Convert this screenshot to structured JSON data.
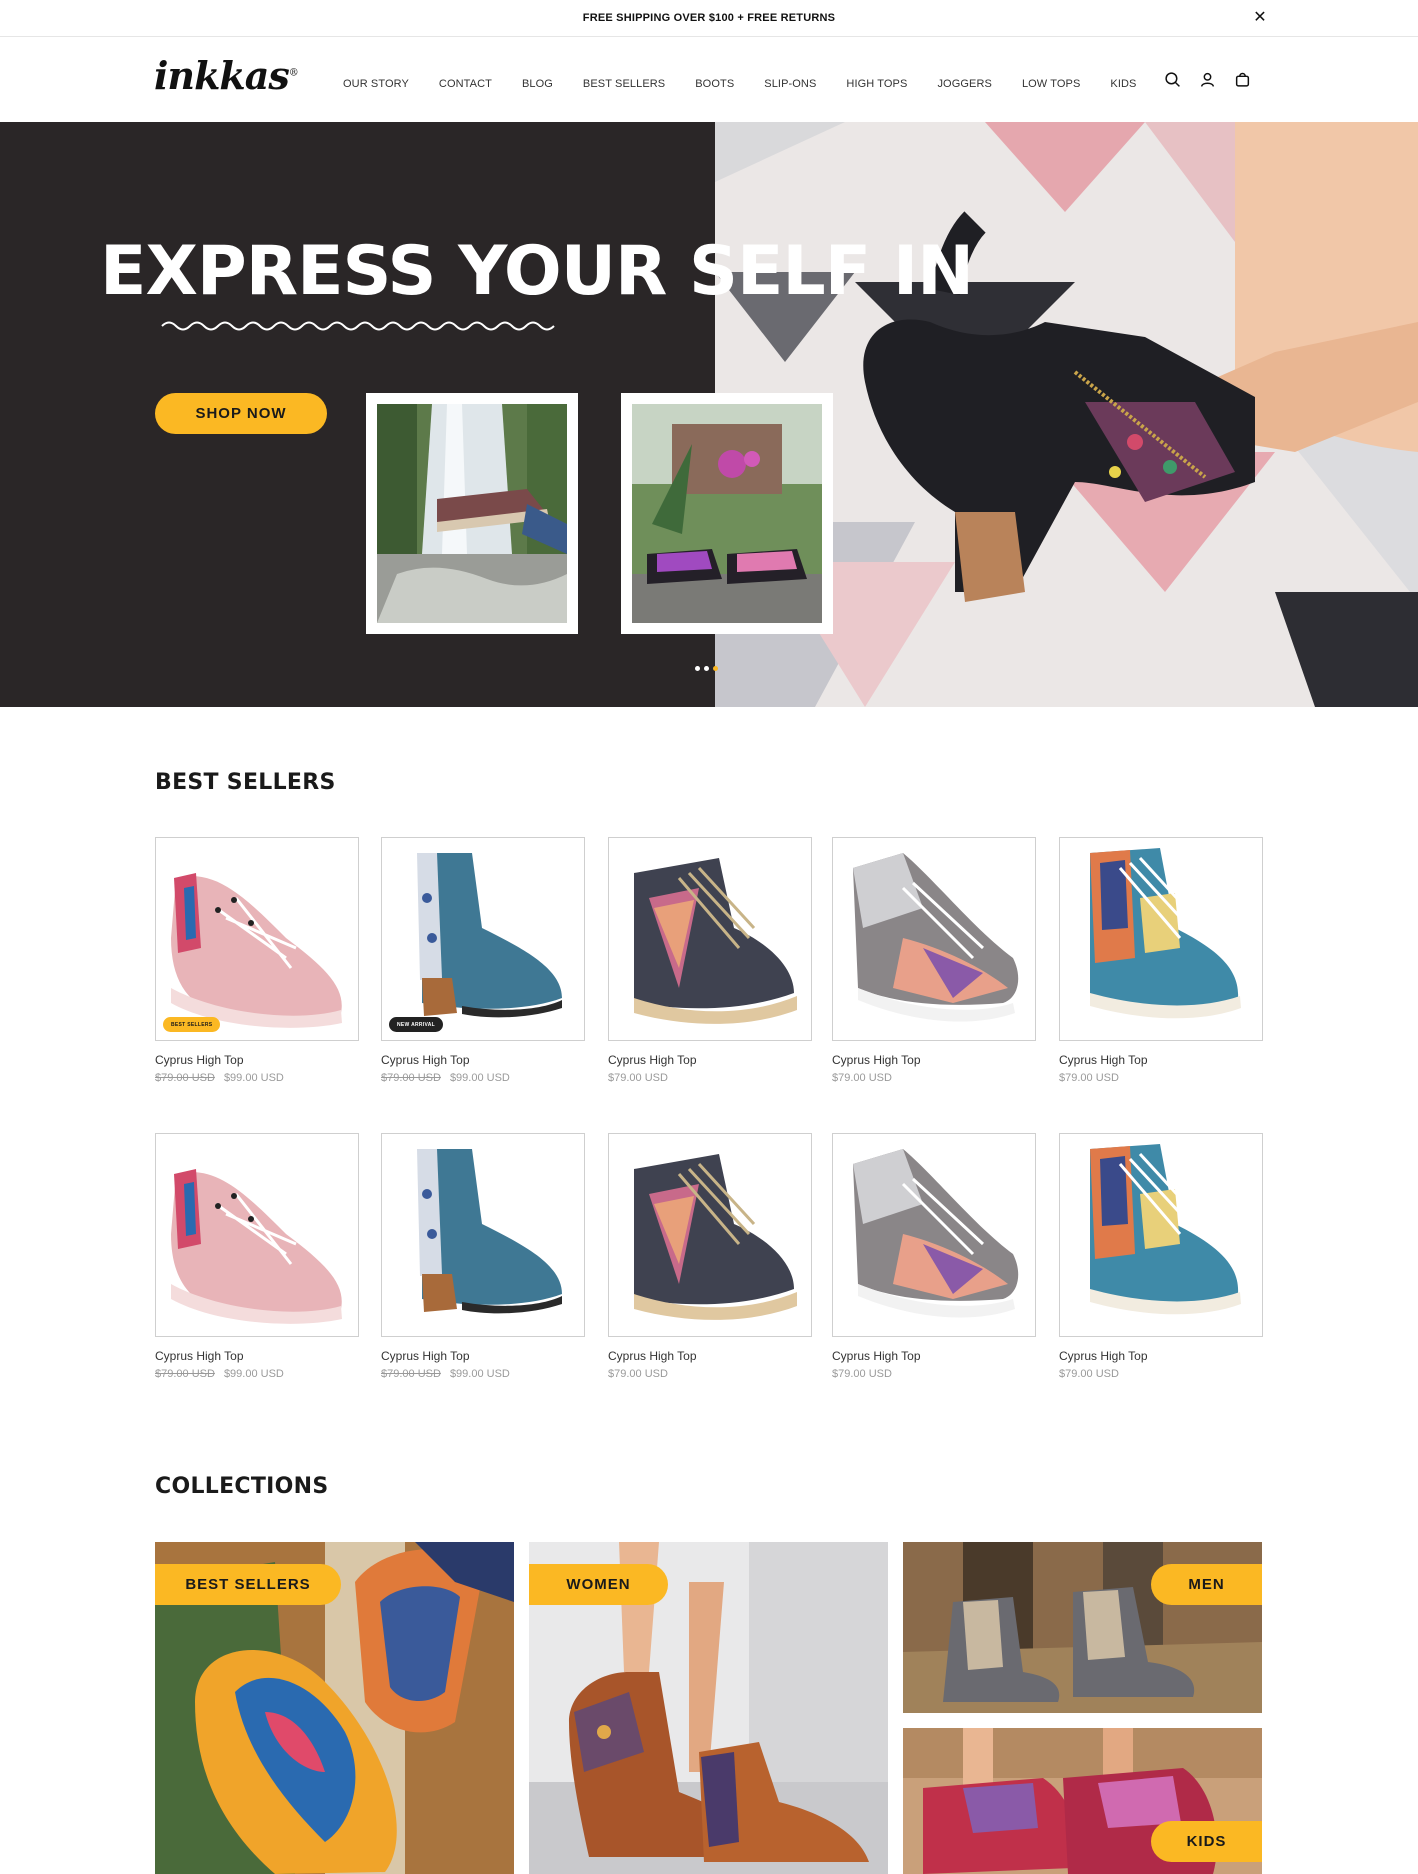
{
  "announcement": {
    "text": "FREE SHIPPING OVER $100 + FREE RETURNS",
    "close": "✕"
  },
  "header": {
    "logo": "inkkas",
    "logo_mark": "®",
    "nav": [
      "OUR STORY",
      "CONTACT",
      "BLOG",
      "BEST SELLERS",
      "BOOTS",
      "SLIP-ONS",
      "HIGH TOPS",
      "JOGGERS",
      "LOW TOPS",
      "KIDS"
    ],
    "icons": [
      "search-icon",
      "account-icon",
      "cart-icon"
    ]
  },
  "hero": {
    "title": "EXPRESS YOUR SELF IN",
    "cta": "SHOP NOW",
    "slides": 3,
    "active_slide": 3
  },
  "best_sellers": {
    "title": "BEST SELLERS",
    "products": [
      {
        "name": "Cyprus High Top",
        "old_price": "$79.00 USD",
        "price": "$99.00 USD",
        "badge": "BEST SELLERS",
        "style": "pink-low"
      },
      {
        "name": "Cyprus High Top",
        "old_price": "$79.00 USD",
        "price": "$99.00 USD",
        "badge": "NEW ARRIVAL",
        "style": "blue-boot"
      },
      {
        "name": "Cyprus High Top",
        "old_price": "",
        "price": "$79.00 USD",
        "badge": "",
        "style": "dark-high"
      },
      {
        "name": "Cyprus High Top",
        "old_price": "",
        "price": "$79.00 USD",
        "badge": "",
        "style": "grey-jogger"
      },
      {
        "name": "Cyprus High Top",
        "old_price": "",
        "price": "$79.00 USD",
        "badge": "",
        "style": "patch-high"
      },
      {
        "name": "Cyprus High Top",
        "old_price": "$79.00 USD",
        "price": "$99.00 USD",
        "badge": "",
        "style": "pink-low"
      },
      {
        "name": "Cyprus High Top",
        "old_price": "$79.00 USD",
        "price": "$99.00 USD",
        "badge": "",
        "style": "blue-boot"
      },
      {
        "name": "Cyprus High Top",
        "old_price": "",
        "price": "$79.00 USD",
        "badge": "",
        "style": "dark-high"
      },
      {
        "name": "Cyprus High Top",
        "old_price": "",
        "price": "$79.00 USD",
        "badge": "",
        "style": "grey-jogger"
      },
      {
        "name": "Cyprus High Top",
        "old_price": "",
        "price": "$79.00 USD",
        "badge": "",
        "style": "patch-high"
      }
    ]
  },
  "collections": {
    "title": "COLLECTIONS",
    "items": [
      "BEST SELLERS",
      "WOMEN",
      "MEN",
      "KIDS"
    ]
  },
  "colors": {
    "accent": "#fbb823",
    "hero_dark": "#2a2627"
  }
}
